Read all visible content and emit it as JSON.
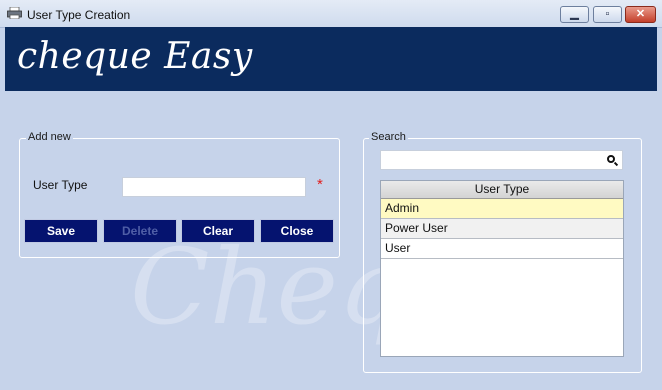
{
  "window": {
    "title": "User Type Creation",
    "icon": "printer-icon",
    "controls": [
      "minimize-icon",
      "maximize-icon",
      "close-icon"
    ]
  },
  "banner": {
    "brand": "cheque Easy",
    "background": "#0b2b5e"
  },
  "watermark": "Cheques",
  "add_new": {
    "legend": "Add new",
    "user_type_label": "User Type",
    "user_type_value": "",
    "required_marker": "*",
    "buttons": {
      "save": "Save",
      "delete": "Delete",
      "clear": "Clear",
      "close": "Close"
    }
  },
  "search": {
    "legend": "Search",
    "query": "",
    "column_header": "User Type",
    "rows": [
      "Admin",
      "Power User",
      "User"
    ]
  },
  "colors": {
    "button": "#05136f",
    "selected_row": "#fffac2",
    "required": "#e21b1b"
  }
}
